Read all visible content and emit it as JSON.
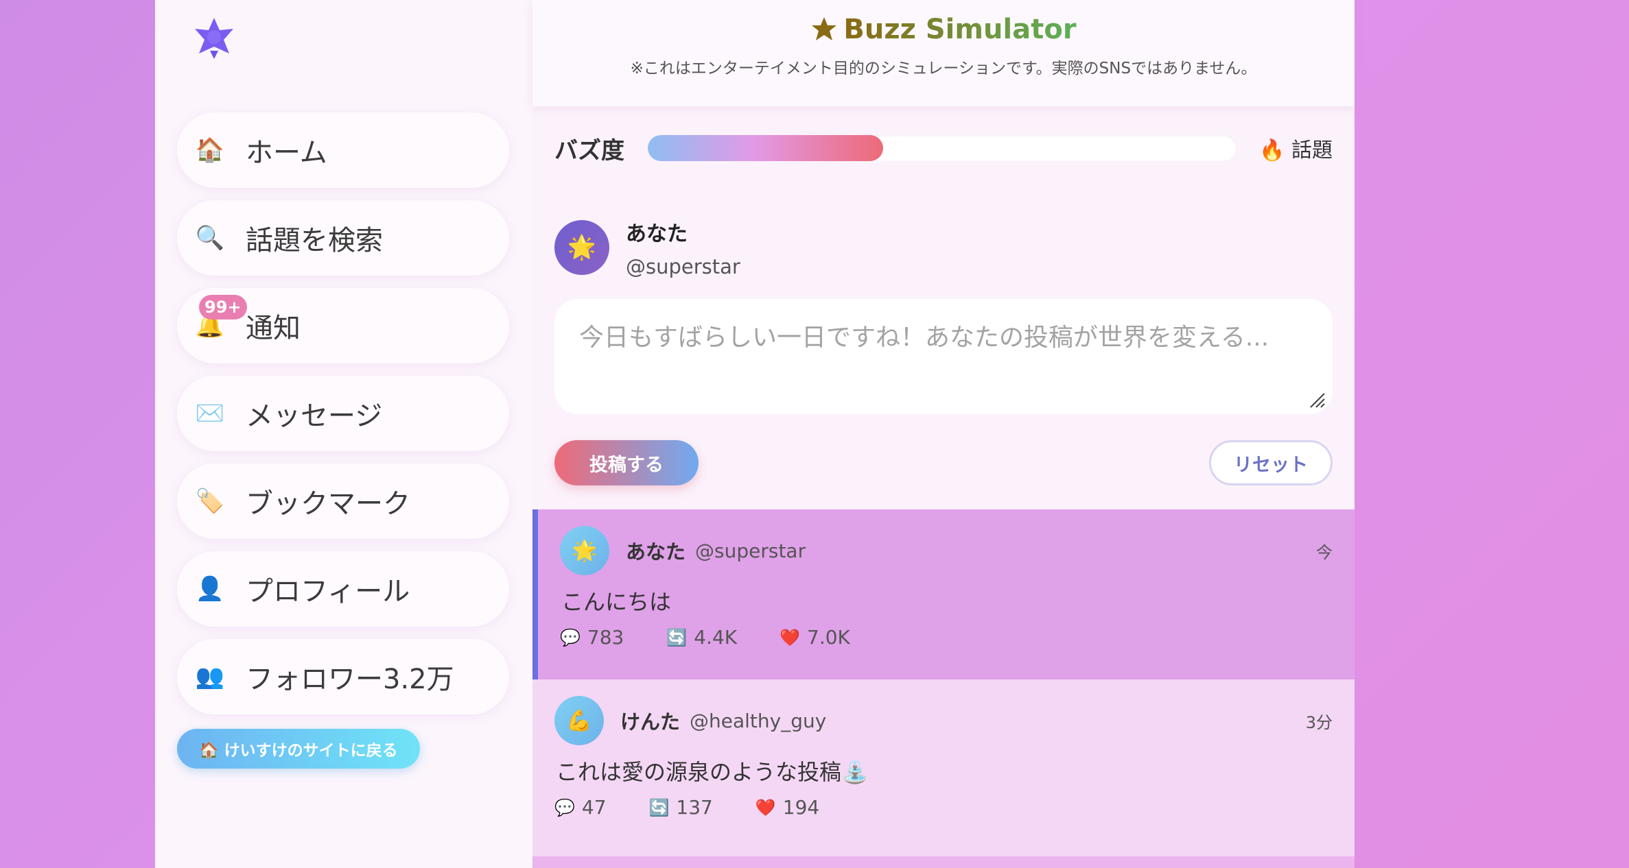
{
  "app": {
    "title": "Buzz Simulator",
    "subtitle": "※これはエンターテイメント目的のシミュレーションです。実際のSNSではありません。"
  },
  "sidebar": {
    "logo_icon": "star-burst-icon",
    "items": [
      {
        "icon": "🏠",
        "icon_name": "home-icon",
        "label": "ホーム"
      },
      {
        "icon": "🔍",
        "icon_name": "search-icon",
        "label": "話題を検索"
      },
      {
        "icon": "🔔",
        "icon_name": "bell-icon",
        "label": "通知",
        "badge": "99+"
      },
      {
        "icon": "✉️",
        "icon_name": "envelope-icon",
        "label": "メッセージ"
      },
      {
        "icon": "🏷️",
        "icon_name": "bookmark-icon",
        "label": "ブックマーク"
      },
      {
        "icon": "👤",
        "icon_name": "profile-icon",
        "label": "プロフィール"
      },
      {
        "icon": "👥",
        "icon_name": "followers-icon",
        "label": "フォロワー3.2万"
      }
    ],
    "back_link": "🏠 けいすけのサイトに戻る"
  },
  "buzz": {
    "label": "バズ度",
    "level": 0.4,
    "status": "🔥 話題"
  },
  "composer": {
    "avatar": "🌟",
    "name": "あなた",
    "handle": "@superstar",
    "placeholder": "今日もすばらしい一日ですね！あなたの投稿が世界を変える...",
    "post_label": "投稿する",
    "reset_label": "リセット"
  },
  "posts": [
    {
      "avatar": "🌟",
      "name": "あなた",
      "handle": "@superstar",
      "time": "今",
      "body": "こんにちは",
      "replies": "783",
      "reposts": "4.4K",
      "likes": "7.0K"
    },
    {
      "avatar": "💪",
      "name": "けんた",
      "handle": "@healthy_guy",
      "time": "3分",
      "body": "これは愛の源泉のような投稿⛲",
      "replies": "47",
      "reposts": "137",
      "likes": "194"
    }
  ],
  "colors": {
    "accent": "#6c6fe0",
    "post_button_start": "#ee6a78",
    "post_button_end": "#70aaf0",
    "buzz_fill_end": "#ec6a78"
  }
}
